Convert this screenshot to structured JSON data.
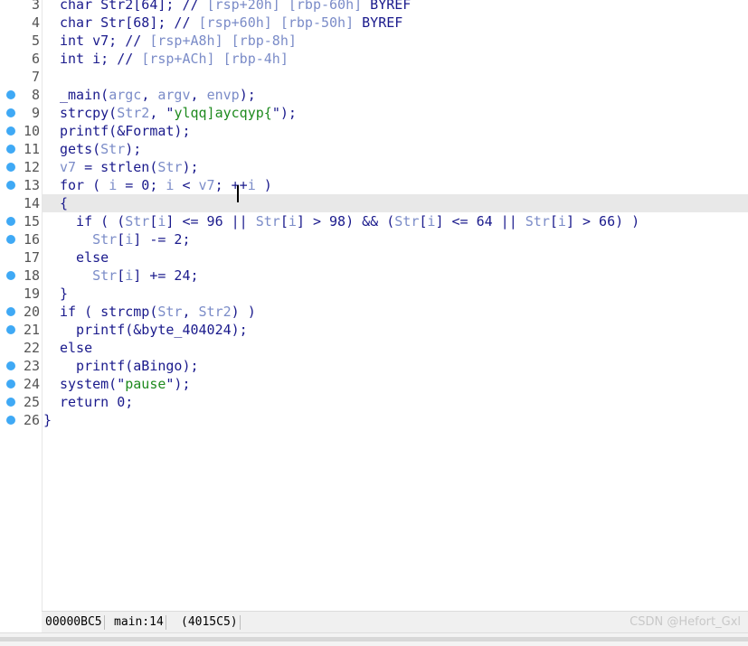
{
  "editor": {
    "lines": [
      {
        "num": "3",
        "bp": false,
        "tokens": [
          {
            "t": "char Str2[64]; // "
          },
          {
            "t": "[rsp+20h] [rbp-60h]",
            "c": "var"
          },
          {
            "t": " BYREF"
          }
        ]
      },
      {
        "num": "4",
        "bp": false,
        "tokens": [
          {
            "t": "char Str[68]; // "
          },
          {
            "t": "[rsp+60h] [rbp-50h]",
            "c": "var"
          },
          {
            "t": " BYREF"
          }
        ]
      },
      {
        "num": "5",
        "bp": false,
        "tokens": [
          {
            "t": "int v7; // "
          },
          {
            "t": "[rsp+A8h] [rbp-8h]",
            "c": "var"
          }
        ]
      },
      {
        "num": "6",
        "bp": false,
        "tokens": [
          {
            "t": "int i; // "
          },
          {
            "t": "[rsp+ACh] [rbp-4h]",
            "c": "var"
          }
        ]
      },
      {
        "num": "7",
        "bp": false,
        "tokens": []
      },
      {
        "num": "8",
        "bp": true,
        "tokens": [
          {
            "t": "_main("
          },
          {
            "t": "argc",
            "c": "var"
          },
          {
            "t": ", "
          },
          {
            "t": "argv",
            "c": "var"
          },
          {
            "t": ", "
          },
          {
            "t": "envp",
            "c": "var"
          },
          {
            "t": ");"
          }
        ]
      },
      {
        "num": "9",
        "bp": true,
        "tokens": [
          {
            "t": "strcpy("
          },
          {
            "t": "Str2",
            "c": "var"
          },
          {
            "t": ", \""
          },
          {
            "t": "ylqq]aycqyp{",
            "c": "str"
          },
          {
            "t": "\");"
          }
        ]
      },
      {
        "num": "10",
        "bp": true,
        "tokens": [
          {
            "t": "printf(&Format);"
          }
        ]
      },
      {
        "num": "11",
        "bp": true,
        "tokens": [
          {
            "t": "gets("
          },
          {
            "t": "Str",
            "c": "var"
          },
          {
            "t": ");"
          }
        ]
      },
      {
        "num": "12",
        "bp": true,
        "tokens": [
          {
            "t": "v7",
            "c": "var"
          },
          {
            "t": " = strlen("
          },
          {
            "t": "Str",
            "c": "var"
          },
          {
            "t": ");"
          }
        ]
      },
      {
        "num": "13",
        "bp": true,
        "tokens": [
          {
            "t": "for ( "
          },
          {
            "t": "i",
            "c": "var"
          },
          {
            "t": " = 0; "
          },
          {
            "t": "i",
            "c": "var"
          },
          {
            "t": " < "
          },
          {
            "t": "v7",
            "c": "var"
          },
          {
            "t": "; ++"
          },
          {
            "t": "i",
            "c": "var"
          },
          {
            "t": " )"
          }
        ]
      },
      {
        "num": "14",
        "bp": false,
        "hl": true,
        "tokens": [
          {
            "t": "{"
          }
        ]
      },
      {
        "num": "15",
        "bp": true,
        "tokens": [
          {
            "t": "  if ( ("
          },
          {
            "t": "Str",
            "c": "var"
          },
          {
            "t": "["
          },
          {
            "t": "i",
            "c": "var"
          },
          {
            "t": "] <= 96 || "
          },
          {
            "t": "Str",
            "c": "var"
          },
          {
            "t": "["
          },
          {
            "t": "i",
            "c": "var"
          },
          {
            "t": "] > 98) && ("
          },
          {
            "t": "Str",
            "c": "var"
          },
          {
            "t": "["
          },
          {
            "t": "i",
            "c": "var"
          },
          {
            "t": "] <= 64 || "
          },
          {
            "t": "Str",
            "c": "var"
          },
          {
            "t": "["
          },
          {
            "t": "i",
            "c": "var"
          },
          {
            "t": "] > 66) )"
          }
        ]
      },
      {
        "num": "16",
        "bp": true,
        "tokens": [
          {
            "t": "    "
          },
          {
            "t": "Str",
            "c": "var"
          },
          {
            "t": "["
          },
          {
            "t": "i",
            "c": "var"
          },
          {
            "t": "] -= 2;"
          }
        ]
      },
      {
        "num": "17",
        "bp": false,
        "tokens": [
          {
            "t": "  else"
          }
        ]
      },
      {
        "num": "18",
        "bp": true,
        "tokens": [
          {
            "t": "    "
          },
          {
            "t": "Str",
            "c": "var"
          },
          {
            "t": "["
          },
          {
            "t": "i",
            "c": "var"
          },
          {
            "t": "] += 24;"
          }
        ]
      },
      {
        "num": "19",
        "bp": false,
        "tokens": [
          {
            "t": "}"
          }
        ]
      },
      {
        "num": "20",
        "bp": true,
        "tokens": [
          {
            "t": "if ( strcmp("
          },
          {
            "t": "Str",
            "c": "var"
          },
          {
            "t": ", "
          },
          {
            "t": "Str2",
            "c": "var"
          },
          {
            "t": ") )"
          }
        ]
      },
      {
        "num": "21",
        "bp": true,
        "tokens": [
          {
            "t": "  printf(&byte_404024);"
          }
        ]
      },
      {
        "num": "22",
        "bp": false,
        "tokens": [
          {
            "t": "else"
          }
        ]
      },
      {
        "num": "23",
        "bp": true,
        "tokens": [
          {
            "t": "  printf(aBingo);"
          }
        ]
      },
      {
        "num": "24",
        "bp": true,
        "tokens": [
          {
            "t": "system(\""
          },
          {
            "t": "pause",
            "c": "str"
          },
          {
            "t": "\");"
          }
        ]
      },
      {
        "num": "25",
        "bp": true,
        "tokens": [
          {
            "t": "return 0;"
          }
        ]
      },
      {
        "num": "26",
        "bp": true,
        "outdent": true,
        "tokens": [
          {
            "t": "}"
          }
        ]
      }
    ]
  },
  "status": {
    "address": "00000BC5",
    "location": "main:14",
    "ea": "(4015C5)",
    "watermark": "CSDN @Hefort_Gxl"
  },
  "colors": {
    "keyword": "#1a1a8c",
    "variable": "#7b8cc8",
    "string": "#1e8a1e",
    "breakpoint": "#3fa9f5",
    "current_line": "#e8e8e8"
  }
}
